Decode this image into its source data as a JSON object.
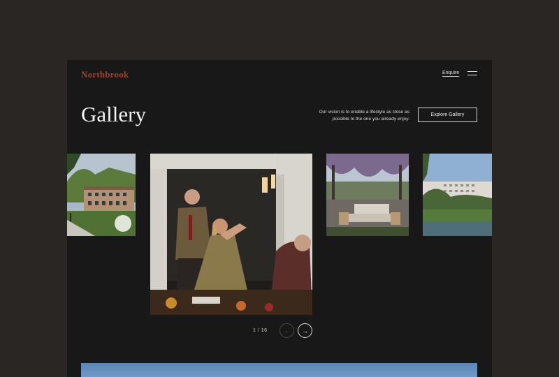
{
  "brand": {
    "logo": "Northbrook",
    "accent": "#a0432d"
  },
  "header": {
    "enquire_label": "Enquire",
    "menu_icon": "hamburger-menu-icon"
  },
  "gallery": {
    "title": "Gallery",
    "vision_text": "Our vision is to enable a lifestyle as close as possible to the one you already enjoy.",
    "explore_label": "Explore Gallery",
    "current_page": 1,
    "total_pages": 16,
    "counter": "1 / 16",
    "prev_arrow": "←",
    "next_arrow": "→"
  }
}
